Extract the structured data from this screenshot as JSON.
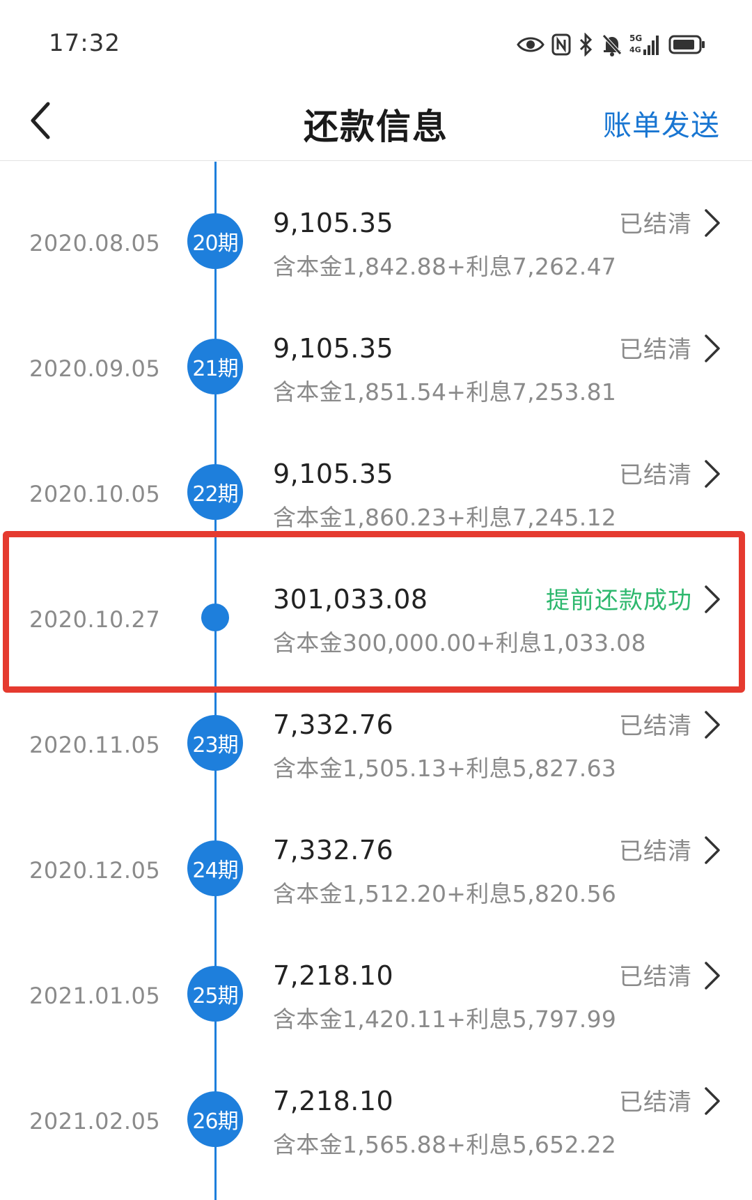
{
  "status_bar": {
    "time": "17:32",
    "icons": [
      "eye-icon",
      "nfc-icon",
      "bluetooth-icon",
      "bell-mute-icon",
      "signal-5g-icon",
      "battery-icon"
    ],
    "network_label_top": "5G",
    "network_label_bottom": "4G"
  },
  "header": {
    "title": "还款信息",
    "action_label": "账单发送",
    "accent_color": "#1976d2"
  },
  "timeline": {
    "line_color": "#1e7fdc",
    "records": [
      {
        "date": "2020.08.05",
        "period": "20期",
        "amount": "9,105.35",
        "breakdown": "含本金1,842.88+利息7,262.47",
        "status": "已结清"
      },
      {
        "date": "2020.09.05",
        "period": "21期",
        "amount": "9,105.35",
        "breakdown": "含本金1,851.54+利息7,253.81",
        "status": "已结清"
      },
      {
        "date": "2020.10.05",
        "period": "22期",
        "amount": "9,105.35",
        "breakdown": "含本金1,860.23+利息7,245.12",
        "status": "已结清"
      },
      {
        "date": "2020.10.27",
        "period": "",
        "amount": "301,033.08",
        "breakdown": "含本金300,000.00+利息1,033.08",
        "status": "提前还款成功",
        "highlighted": true
      },
      {
        "date": "2020.11.05",
        "period": "23期",
        "amount": "7,332.76",
        "breakdown": "含本金1,505.13+利息5,827.63",
        "status": "已结清"
      },
      {
        "date": "2020.12.05",
        "period": "24期",
        "amount": "7,332.76",
        "breakdown": "含本金1,512.20+利息5,820.56",
        "status": "已结清"
      },
      {
        "date": "2021.01.05",
        "period": "25期",
        "amount": "7,218.10",
        "breakdown": "含本金1,420.11+利息5,797.99",
        "status": "已结清"
      },
      {
        "date": "2021.02.05",
        "period": "26期",
        "amount": "7,218.10",
        "breakdown": "含本金1,565.88+利息5,652.22",
        "status": "已结清"
      }
    ]
  },
  "colors": {
    "success_status": "#2eb86e",
    "highlight_border": "#e53a2f",
    "muted_text": "#8a8a8a"
  }
}
